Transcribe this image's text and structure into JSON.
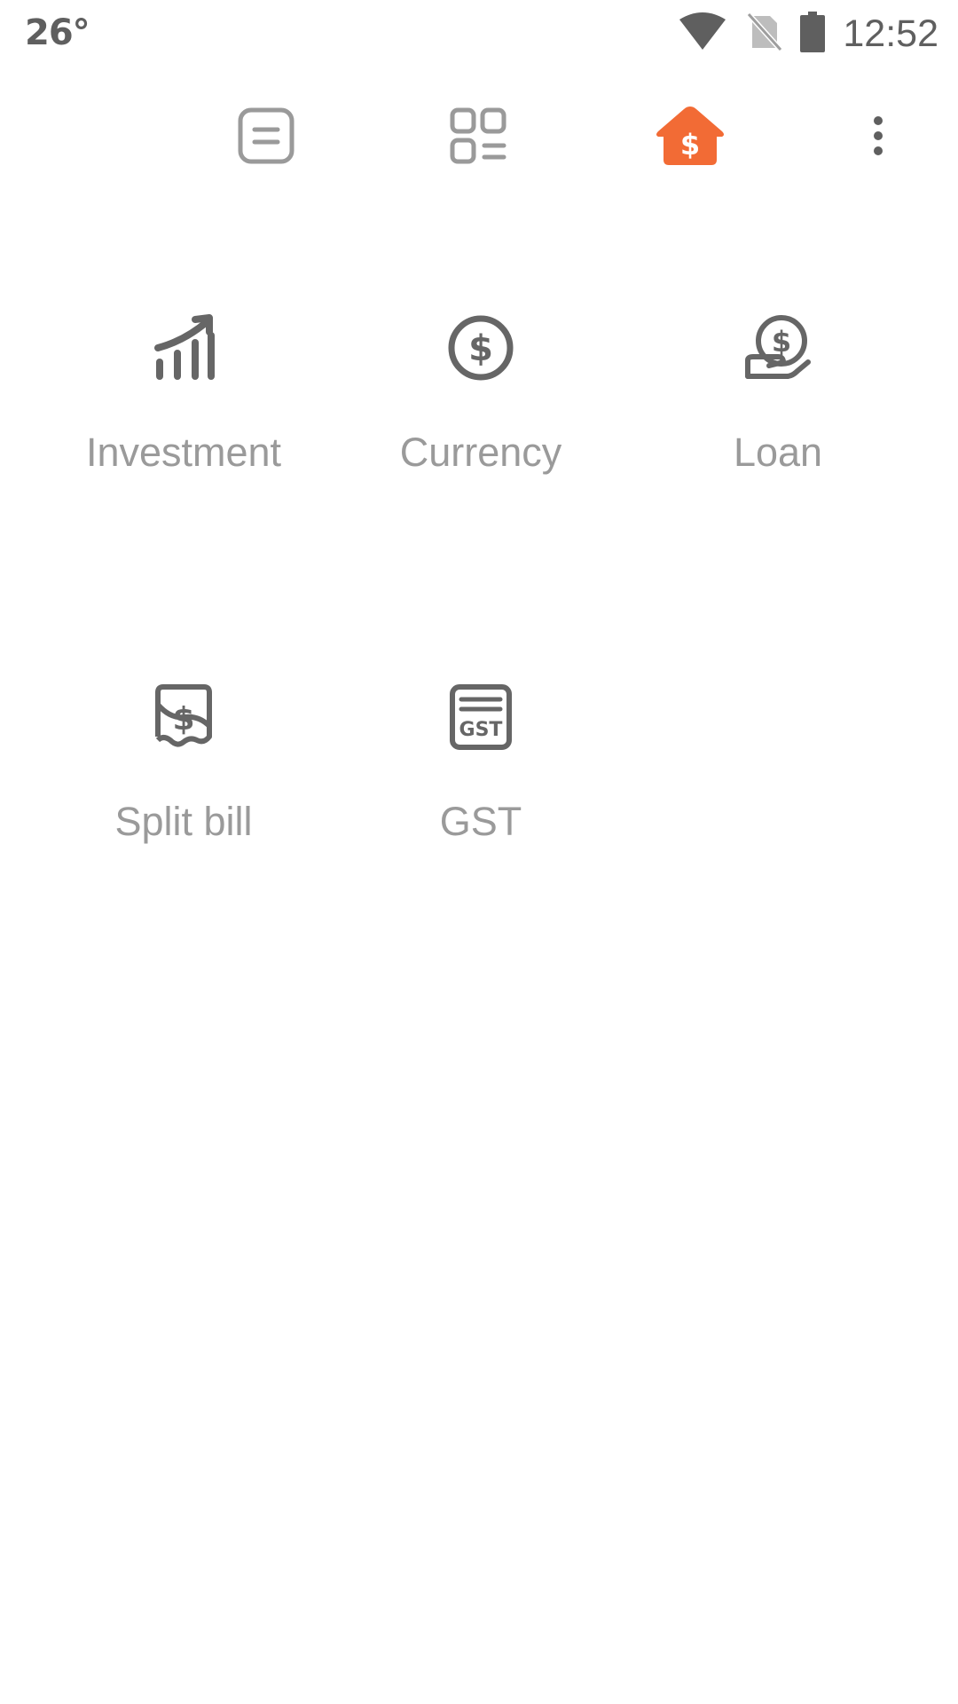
{
  "status_bar": {
    "temperature": "26°",
    "time": "12:52",
    "icons": [
      "wifi-icon",
      "no-sim-icon",
      "battery-icon"
    ]
  },
  "toolbar": {
    "items": [
      {
        "icon": "notes-icon",
        "active": false
      },
      {
        "icon": "widgets-icon",
        "active": false
      },
      {
        "icon": "finance-home-icon",
        "active": true
      },
      {
        "icon": "more-vert-icon",
        "active": false
      }
    ]
  },
  "tools": [
    {
      "label": "Investment",
      "icon": "investment-chart-icon"
    },
    {
      "label": "Currency",
      "icon": "currency-icon"
    },
    {
      "label": "Loan",
      "icon": "loan-icon"
    },
    {
      "label": "Split bill",
      "icon": "split-bill-icon"
    },
    {
      "label": "GST",
      "icon": "gst-icon"
    }
  ],
  "colors": {
    "accent": "#F26B35",
    "icon_gray": "#666666",
    "label_gray": "#9A9A9A",
    "status_gray": "#5F5F5F",
    "background": "#FFFFFF"
  }
}
